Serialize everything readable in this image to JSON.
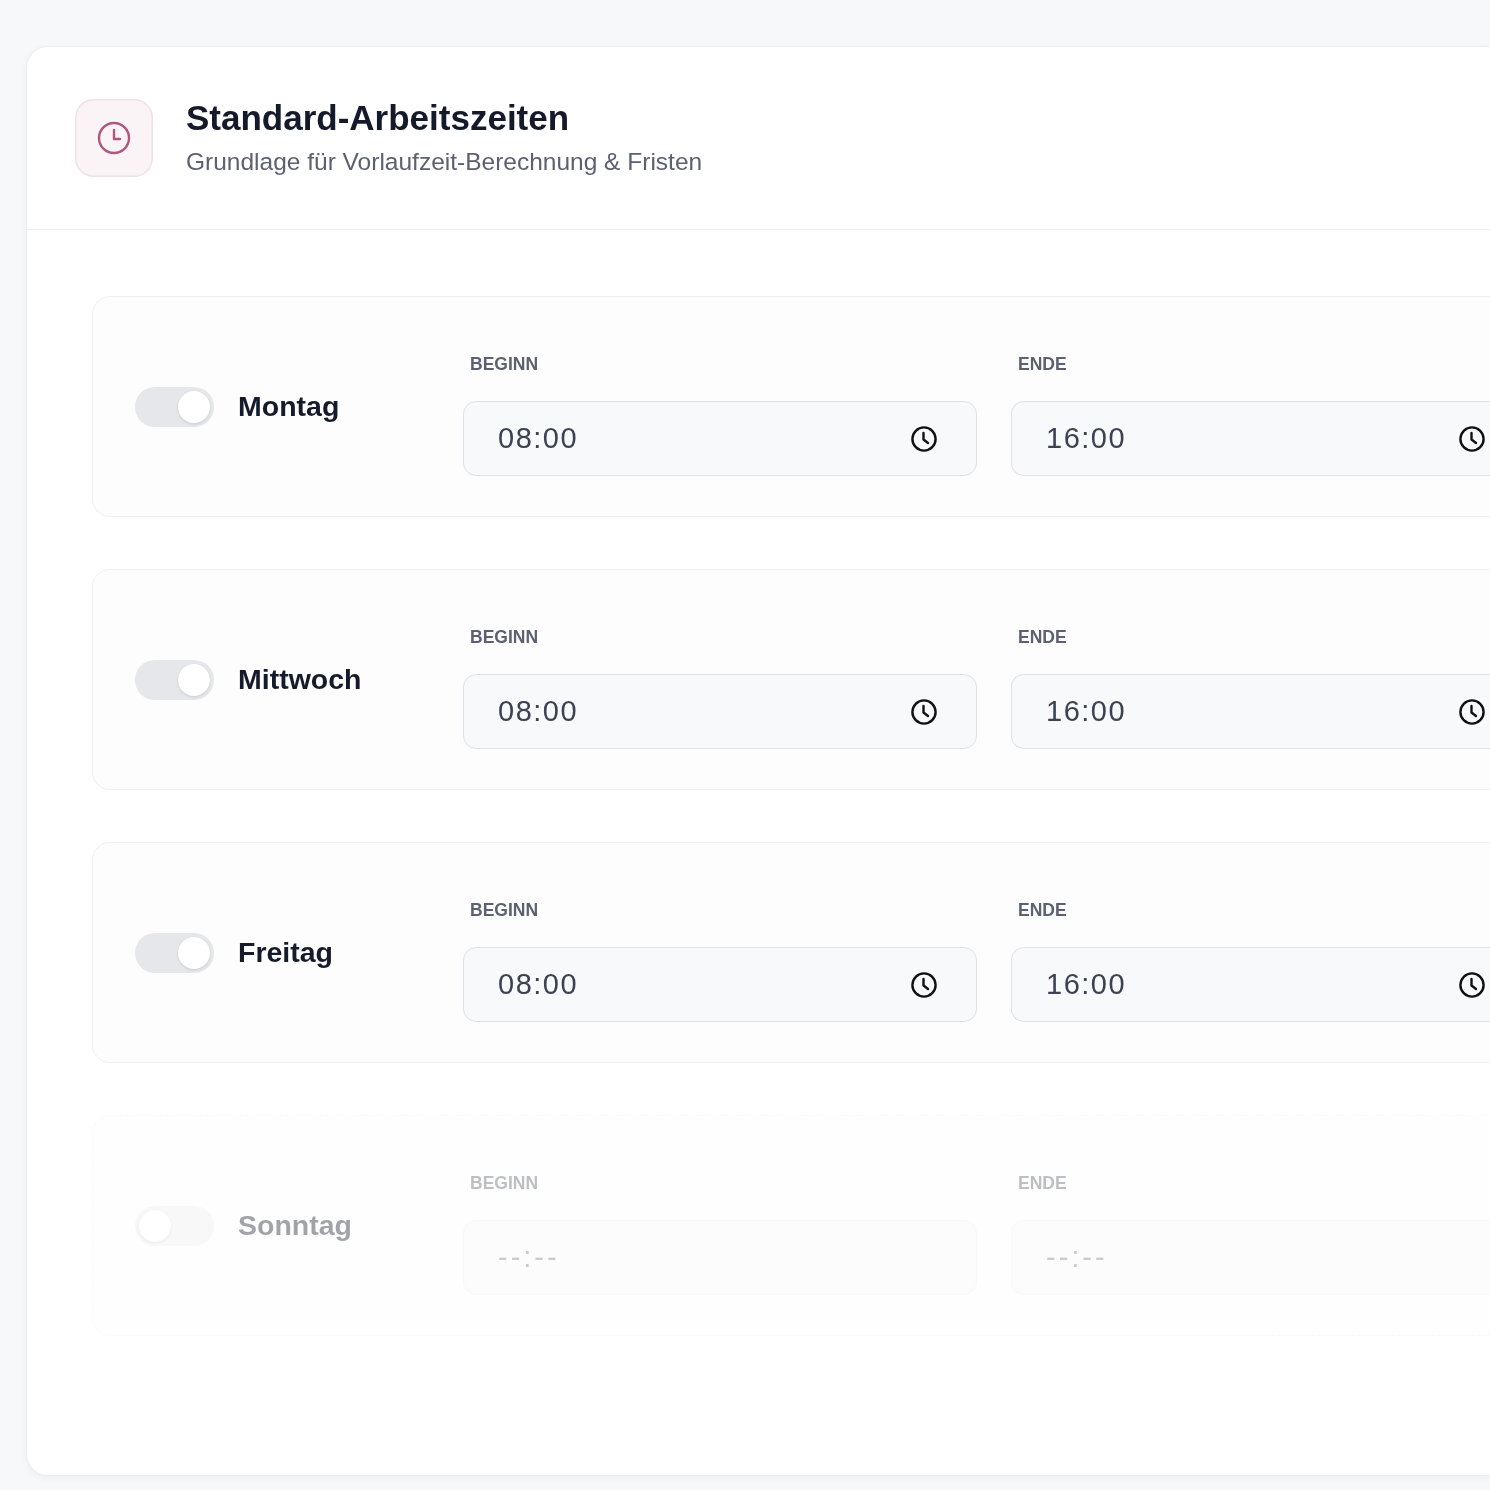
{
  "header": {
    "title": "Standard-Arbeitszeiten",
    "subtitle": "Grundlage für Vorlaufzeit-Berechnung & Fristen"
  },
  "days": [
    {
      "name": "Montag",
      "enabled": true,
      "start": {
        "label": "BEGINN",
        "value": "08:00"
      },
      "end": {
        "label": "ENDE",
        "value": "16:00"
      }
    },
    {
      "name": "Mittwoch",
      "enabled": true,
      "start": {
        "label": "BEGINN",
        "value": "08:00"
      },
      "end": {
        "label": "ENDE",
        "value": "16:00"
      }
    },
    {
      "name": "Freitag",
      "enabled": true,
      "start": {
        "label": "BEGINN",
        "value": "08:00"
      },
      "end": {
        "label": "ENDE",
        "value": "16:00"
      }
    },
    {
      "name": "Sonntag",
      "enabled": false,
      "start": {
        "label": "BEGINN",
        "placeholder": "--:--"
      },
      "end": {
        "label": "ENDE",
        "placeholder": "--:--"
      }
    }
  ]
}
